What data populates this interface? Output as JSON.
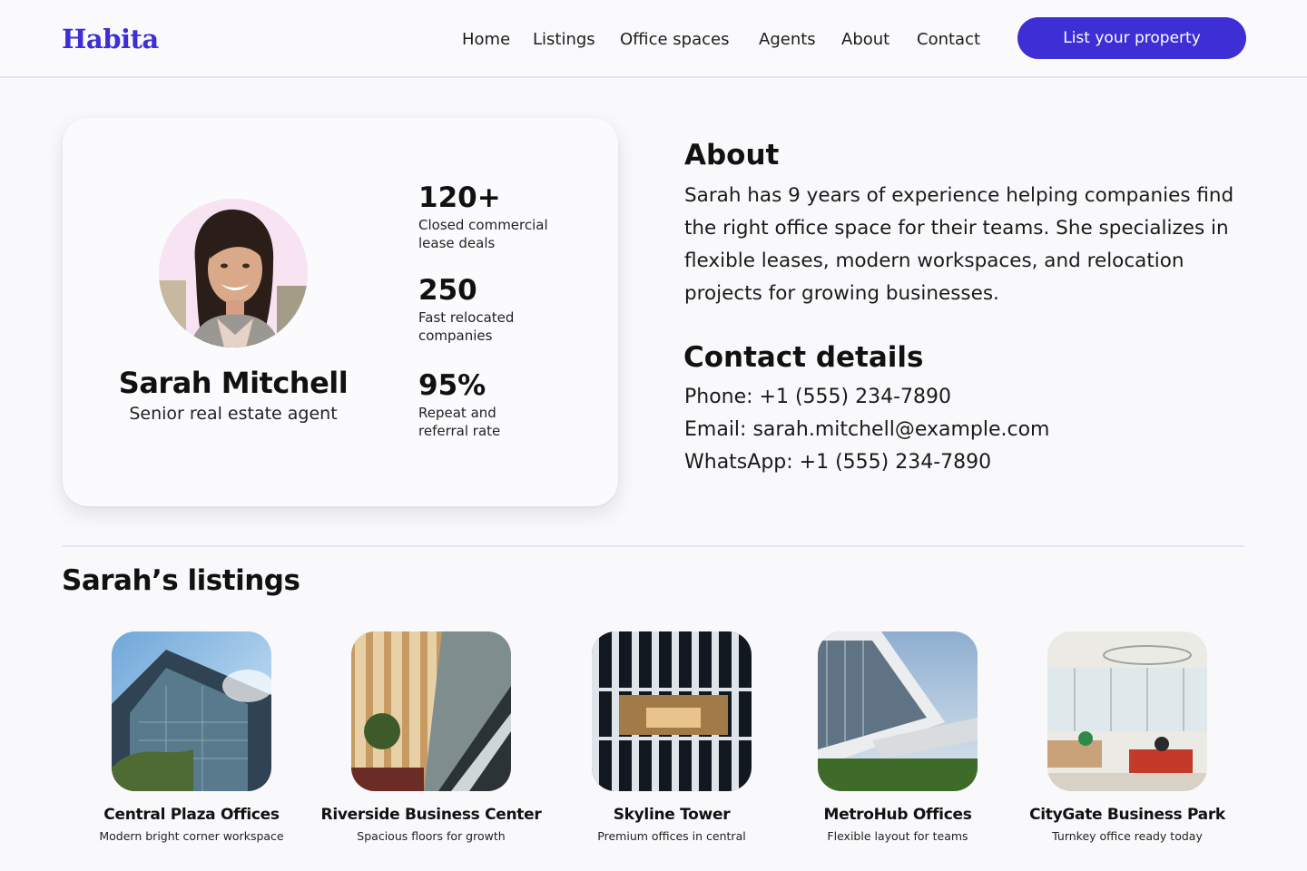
{
  "nav": {
    "logo": "Habita",
    "links": [
      "Home",
      "Listings",
      "Office spaces",
      "Agents",
      "About",
      "Contact"
    ],
    "cta_label": "List your property"
  },
  "profile": {
    "name": "Sarah Mitchell",
    "role": "Senior real estate agent",
    "stats": [
      {
        "value": "120+",
        "label_line1": "Closed commercial",
        "label_line2": "lease deals"
      },
      {
        "value": "250",
        "label_line1": "Fast relocated",
        "label_line2": "companies"
      },
      {
        "value": "95%",
        "label_line1": "Repeat and",
        "label_line2": "referral rate"
      }
    ]
  },
  "about": {
    "title": "About",
    "text": "Sarah has 9 years of experience helping companies find the right office space for their teams. She specializes in flexible leases, modern workspaces, and relocation projects for growing businesses."
  },
  "contact": {
    "title": "Contact details",
    "phone": "Phone: +1 (555) 234-7890",
    "email": "Email: sarah.mitchell@example.com",
    "whatsapp": "WhatsApp: +1 (555) 234-7890"
  },
  "listings": {
    "title": "Sarah’s listings",
    "items": [
      {
        "name": "Central Plaza Offices",
        "desc": "Modern bright corner workspace"
      },
      {
        "name": "Riverside Business Center",
        "desc": "Spacious floors for growth"
      },
      {
        "name": "Skyline Tower",
        "desc": "Premium offices in central"
      },
      {
        "name": "MetroHub Offices",
        "desc": "Flexible layout for teams"
      },
      {
        "name": "CityGate Business Park",
        "desc": "Turnkey office ready today"
      }
    ]
  },
  "colors": {
    "brand": "#3d2ed6",
    "background": "#f9f9fb",
    "divider": "#e3e3f4"
  }
}
